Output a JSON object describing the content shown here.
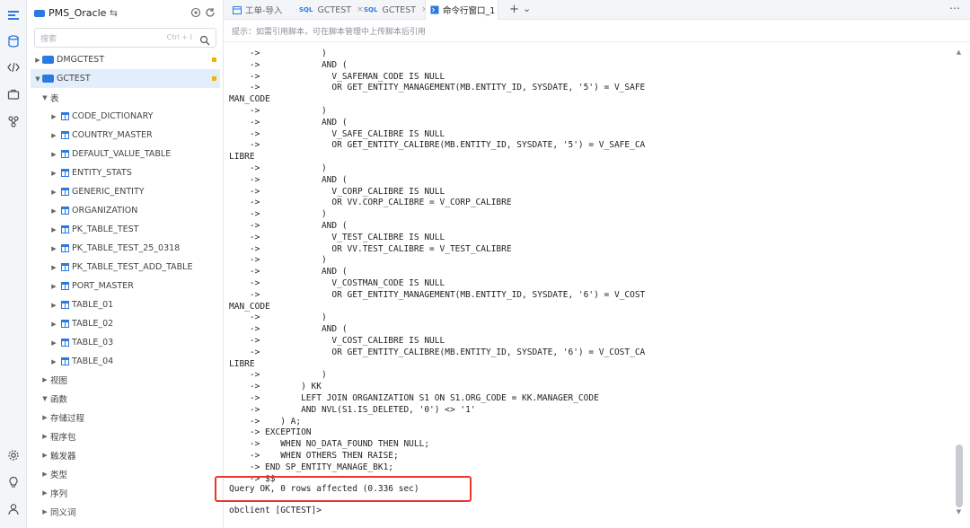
{
  "rail": {
    "icons": [
      "logo-icon",
      "database-icon",
      "code-icon",
      "briefcase-icon",
      "git-icon",
      "settings-icon",
      "bulb-icon",
      "user-icon"
    ]
  },
  "sidebar": {
    "title": "PMS_Oracle",
    "title_suffix": "⇆",
    "search_placeholder": "搜索",
    "search_shortcut": "Ctrl + I",
    "connections": [
      {
        "label": "DMGCTEST",
        "expanded": false
      },
      {
        "label": "GCTEST",
        "expanded": true
      }
    ],
    "groups": {
      "tables": "表",
      "views": "视图",
      "functions": "函数",
      "procedures": "存储过程",
      "packages": "程序包",
      "triggers": "触发器",
      "types": "类型",
      "sequences": "序列",
      "synonyms": "同义词"
    },
    "tables": [
      "CODE_DICTIONARY",
      "COUNTRY_MASTER",
      "DEFAULT_VALUE_TABLE",
      "ENTITY_STATS",
      "GENERIC_ENTITY",
      "ORGANIZATION",
      "PK_TABLE_TEST",
      "PK_TABLE_TEST_25_0318",
      "PK_TABLE_TEST_ADD_TABLE",
      "PORT_MASTER",
      "TABLE_01",
      "TABLE_02",
      "TABLE_03",
      "TABLE_04"
    ]
  },
  "tabs": [
    {
      "label": "工单-导入",
      "kind": "doc"
    },
    {
      "label": "GCTEST",
      "kind": "sql"
    },
    {
      "label": "GCTEST",
      "kind": "sql"
    },
    {
      "label": "命令行窗口_1",
      "kind": "cmd",
      "active": true
    }
  ],
  "tabbar_actions": {
    "add": "+",
    "more": "⌄",
    "menu": "⋯"
  },
  "hint": "提示：如需引用脚本，可在脚本管理中上传脚本后引用",
  "terminal": {
    "lines": [
      "    ->            )",
      "    ->            AND (",
      "    ->              V_SAFEMAN_CODE IS NULL",
      "    ->              OR GET_ENTITY_MANAGEMENT(MB.ENTITY_ID, SYSDATE, '5') = V_SAFE",
      "MAN_CODE",
      "    ->            )",
      "    ->            AND (",
      "    ->              V_SAFE_CALIBRE IS NULL",
      "    ->              OR GET_ENTITY_CALIBRE(MB.ENTITY_ID, SYSDATE, '5') = V_SAFE_CA",
      "LIBRE",
      "    ->            )",
      "    ->            AND (",
      "    ->              V_CORP_CALIBRE IS NULL",
      "    ->              OR VV.CORP_CALIBRE = V_CORP_CALIBRE",
      "    ->            )",
      "    ->            AND (",
      "    ->              V_TEST_CALIBRE IS NULL",
      "    ->              OR VV.TEST_CALIBRE = V_TEST_CALIBRE",
      "    ->            )",
      "    ->            AND (",
      "    ->              V_COSTMAN_CODE IS NULL",
      "    ->              OR GET_ENTITY_MANAGEMENT(MB.ENTITY_ID, SYSDATE, '6') = V_COST",
      "MAN_CODE",
      "    ->            )",
      "    ->            AND (",
      "    ->              V_COST_CALIBRE IS NULL",
      "    ->              OR GET_ENTITY_CALIBRE(MB.ENTITY_ID, SYSDATE, '6') = V_COST_CA",
      "LIBRE",
      "    ->            )",
      "    ->        ) KK",
      "    ->        LEFT JOIN ORGANIZATION S1 ON S1.ORG_CODE = KK.MANAGER_CODE",
      "    ->        AND NVL(S1.IS_DELETED, '0') <> '1'",
      "    ->    ) A;",
      "    -> EXCEPTION",
      "    ->    WHEN NO_DATA_FOUND THEN NULL;",
      "    ->    WHEN OTHERS THEN RAISE;",
      "    -> END SP_ENTITY_MANAGE_BK1;",
      "    -> $$"
    ],
    "result": "Query OK, 0 rows affected (0.336 sec)",
    "prompt": "obclient [GCTEST]>"
  },
  "colors": {
    "accent": "#2a7ae2",
    "highlight": "#e8362f",
    "badge": "#f0b400"
  }
}
